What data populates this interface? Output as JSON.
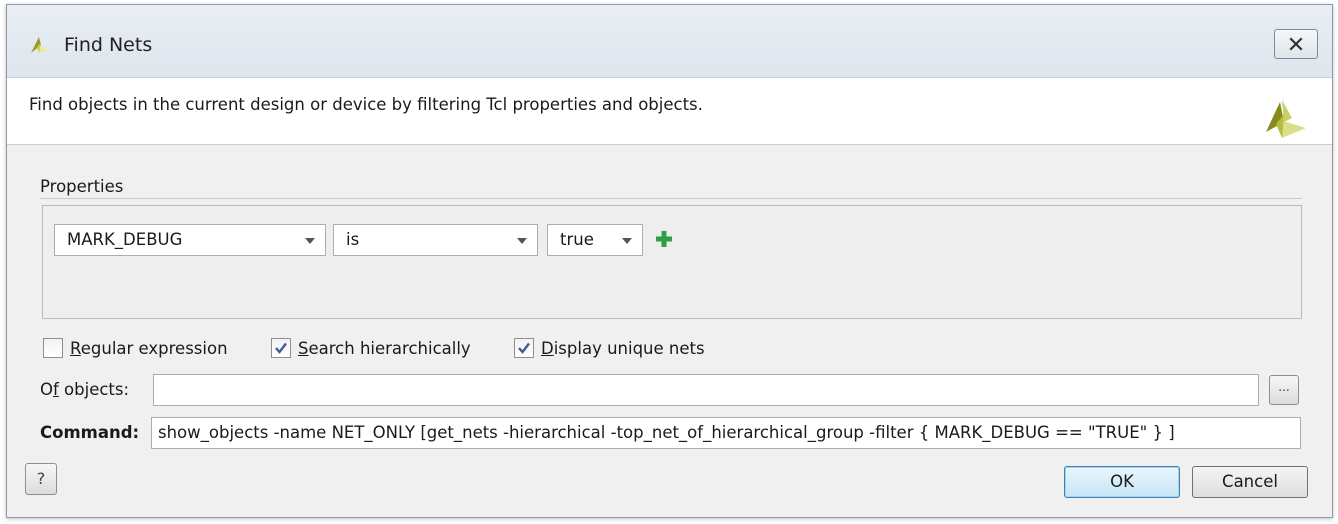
{
  "window": {
    "title": "Find Nets",
    "close_icon": "close-icon"
  },
  "header": {
    "description": "Find objects in the current design or device by filtering Tcl properties and objects."
  },
  "properties": {
    "section_label": "Properties",
    "filter": {
      "property": "MARK_DEBUG",
      "operator": "is",
      "value": "true",
      "add_icon": "plus-icon"
    }
  },
  "options": {
    "regular_expression": {
      "label_mnemonic": "R",
      "label_rest": "egular expression",
      "checked": false
    },
    "search_hierarchically": {
      "label_mnemonic": "S",
      "label_rest": "earch hierarchically",
      "checked": true
    },
    "display_unique_nets": {
      "label_mnemonic": "D",
      "label_rest": "isplay unique nets",
      "checked": true
    }
  },
  "of_objects": {
    "label_pre": "O",
    "label_mnemonic": "f",
    "label_post": " objects:",
    "value": "",
    "browse_label": "..."
  },
  "command": {
    "label": "Command:",
    "value": "show_objects -name NET_ONLY [get_nets -hierarchical -top_net_of_hierarchical_group -filter { MARK_DEBUG == \"TRUE\" } ]"
  },
  "footer": {
    "help_label": "?",
    "ok_label": "OK",
    "cancel_label": "Cancel"
  },
  "colors": {
    "accent_green": "#2ea043",
    "logo_dark": "#8a8a1c",
    "logo_light": "#d8df8a"
  }
}
